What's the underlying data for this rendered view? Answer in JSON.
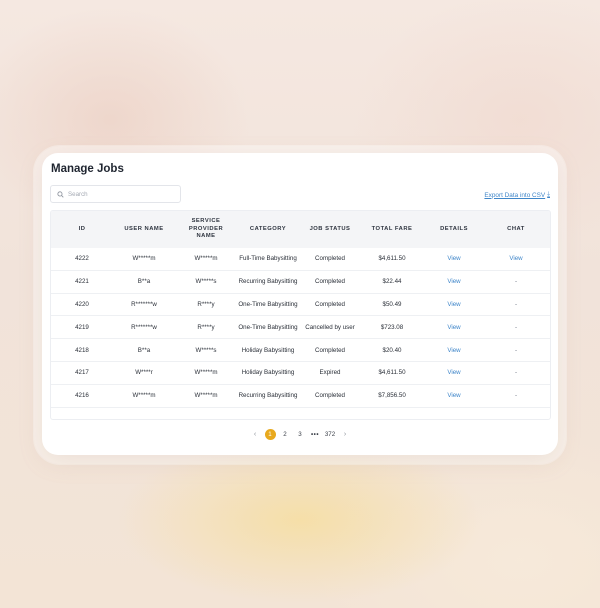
{
  "page": {
    "title": "Manage Jobs",
    "search_placeholder": "Search",
    "export_label": "Export Data into CSV"
  },
  "table": {
    "headers": [
      [
        "ID"
      ],
      [
        "USER NAME"
      ],
      [
        "SERVICE",
        "PROVIDER",
        "NAME"
      ],
      [
        "CATEGORY"
      ],
      [
        "JOB STATUS"
      ],
      [
        "TOTAL FARE"
      ],
      [
        "DETAILS"
      ],
      [
        "CHAT"
      ]
    ],
    "rows": [
      {
        "id": "4222",
        "user": "W*****m",
        "provider": "W*****m",
        "category": "Full-Time Babysitting",
        "status": "Completed",
        "fare": "$4,611.50",
        "details": "View",
        "chat": "View"
      },
      {
        "id": "4221",
        "user": "B**a",
        "provider": "W*****s",
        "category": "Recurring Babysitting",
        "status": "Completed",
        "fare": "$22.44",
        "details": "View",
        "chat": "-"
      },
      {
        "id": "4220",
        "user": "R*******w",
        "provider": "R****y",
        "category": "One-Time Babysitting",
        "status": "Completed",
        "fare": "$50.49",
        "details": "View",
        "chat": "-"
      },
      {
        "id": "4219",
        "user": "R*******w",
        "provider": "R****y",
        "category": "One-Time Babysitting",
        "status": "Cancelled by user",
        "fare": "$723.08",
        "details": "View",
        "chat": "-"
      },
      {
        "id": "4218",
        "user": "B**a",
        "provider": "W*****s",
        "category": "Holiday Babysitting",
        "status": "Completed",
        "fare": "$20.40",
        "details": "View",
        "chat": "-"
      },
      {
        "id": "4217",
        "user": "W****r",
        "provider": "W*****m",
        "category": "Holiday Babysitting",
        "status": "Expired",
        "fare": "$4,611.50",
        "details": "View",
        "chat": "-"
      },
      {
        "id": "4216",
        "user": "W*****m",
        "provider": "W*****m",
        "category": "Recurring Babysitting",
        "status": "Completed",
        "fare": "$7,856.50",
        "details": "View",
        "chat": "-"
      }
    ]
  },
  "pagination": {
    "prev": "‹",
    "pages": [
      "1",
      "2",
      "3"
    ],
    "ellipsis": "•••",
    "last": "372",
    "next": "›",
    "current": "1"
  },
  "colors": {
    "accent": "#e8a91e",
    "link": "#3f86c9"
  }
}
